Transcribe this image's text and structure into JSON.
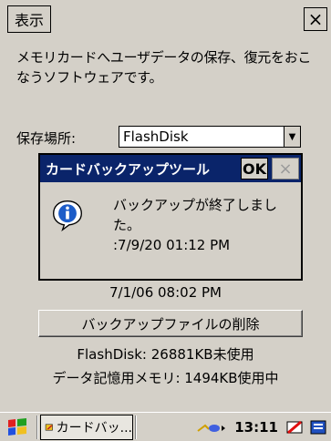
{
  "menu": {
    "label": "表示"
  },
  "window": {
    "close_glyph": "×"
  },
  "description": "メモリカードへユーザデータの保存、復元をおこなうソフトウェアです。",
  "location": {
    "label": "保存場所:",
    "value": "FlashDisk"
  },
  "dialog": {
    "title": "カードバックアップツール",
    "ok_label": "OK",
    "close_glyph": "×",
    "message_line1": "バックアップが終了しました。",
    "message_line2": ":7/9/20 01:12 PM"
  },
  "backup_date": "7/1/06 08:02 PM",
  "delete_button": "バックアップファイルの削除",
  "flashdisk_status": "FlashDisk: 26881KB未使用",
  "memory_status": "データ記憶用メモリ: 1494KB使用中",
  "taskbar": {
    "task_label": "カードバッ...",
    "clock": "13:11"
  },
  "colors": {
    "background": "#d4d0c8",
    "titlebar": "#0a246a",
    "info_icon": "#1c5cc8"
  },
  "icons": [
    "start-flag-icon",
    "card-tool-icon",
    "network-icon",
    "battery-icon",
    "keyboard-icon",
    "info-icon"
  ]
}
